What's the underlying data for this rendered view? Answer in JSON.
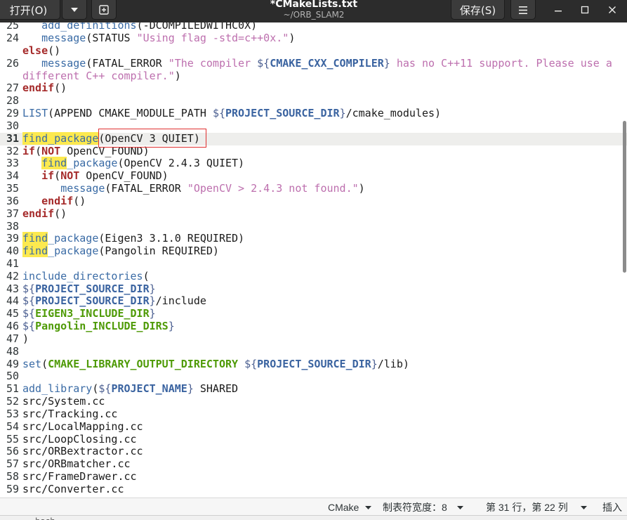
{
  "window": {
    "title": "*CMakeLists.txt",
    "subtitle": "~/ORB_SLAM2"
  },
  "header": {
    "open_label": "打开(O)",
    "save_label": "保存(S)",
    "icons": {
      "open_dropdown": "chevron-down-icon",
      "new_tab": "new-tab-icon",
      "menu": "hamburger-menu-icon",
      "minimize": "minimize-icon",
      "maximize": "maximize-icon",
      "close": "close-icon"
    }
  },
  "syntax_colors": {
    "command": "#3a6ba5",
    "keyword": "#a52a2a",
    "string": "#bd6fae",
    "variable_delimiter": "#4b5f91",
    "variable": "#3a63a0",
    "builtin_variable": "#4e9a06",
    "search_match_bg": "#fce94f",
    "current_line_bg": "#eeeeec",
    "annotation_box": "#e02f2f"
  },
  "editor": {
    "lines": [
      {
        "n": "25",
        "tk": [
          [
            "   ",
            ""
          ],
          [
            "add_definitions",
            "cmd"
          ],
          [
            "(-DCOMPILEDWITHC0X)",
            ""
          ]
        ]
      },
      {
        "n": "24",
        "tk": [
          [
            "   ",
            ""
          ],
          [
            "message",
            "cmd"
          ],
          [
            "(STATUS ",
            ""
          ],
          [
            "\"Using flag -std=c++0x.\"",
            "str"
          ],
          [
            ")",
            ""
          ]
        ]
      },
      {
        "n": "",
        "tk": [
          [
            "else",
            "kw"
          ],
          [
            "()",
            ""
          ]
        ]
      },
      {
        "n": "26",
        "tk": [
          [
            "   ",
            ""
          ],
          [
            "message",
            "cmd"
          ],
          [
            "(FATAL_ERROR ",
            ""
          ],
          [
            "\"The compiler ",
            "str"
          ],
          [
            "${",
            "vd"
          ],
          [
            "CMAKE_CXX_COMPILER",
            "vb"
          ],
          [
            "}",
            "vd"
          ],
          [
            " has no C++11 support. Please use a",
            "str"
          ]
        ]
      },
      {
        "n": "",
        "tk": [
          [
            "different C++ compiler.\"",
            "str"
          ],
          [
            ")",
            ""
          ]
        ]
      },
      {
        "n": "27",
        "tk": [
          [
            "endif",
            "kw"
          ],
          [
            "()",
            ""
          ]
        ]
      },
      {
        "n": "28",
        "tk": []
      },
      {
        "n": "29",
        "tk": [
          [
            "LIST",
            "cmd"
          ],
          [
            "(APPEND CMAKE_MODULE_PATH ",
            ""
          ],
          [
            "${",
            "vd"
          ],
          [
            "PROJECT_SOURCE_DIR",
            "vb"
          ],
          [
            "}",
            "vd"
          ],
          [
            "/cmake_modules)",
            ""
          ]
        ]
      },
      {
        "n": "30",
        "tk": []
      },
      {
        "n": "31",
        "cur": true,
        "tk": [
          [
            "find_package",
            "cmd hl"
          ],
          [
            "(OpenCV 3 QUIET)",
            ""
          ]
        ]
      },
      {
        "n": "32",
        "tk": [
          [
            "if",
            "kw"
          ],
          [
            "(",
            ""
          ],
          [
            "NOT",
            "kw"
          ],
          [
            " OpenCV_FOUND)",
            ""
          ]
        ]
      },
      {
        "n": "33",
        "tk": [
          [
            "   ",
            ""
          ],
          [
            "find",
            "cmd hl"
          ],
          [
            "_package",
            "cmd"
          ],
          [
            "(OpenCV 2.4.3 QUIET)",
            ""
          ]
        ]
      },
      {
        "n": "34",
        "tk": [
          [
            "   ",
            ""
          ],
          [
            "if",
            "kw"
          ],
          [
            "(",
            ""
          ],
          [
            "NOT",
            "kw"
          ],
          [
            " OpenCV_FOUND)",
            ""
          ]
        ]
      },
      {
        "n": "35",
        "tk": [
          [
            "      ",
            ""
          ],
          [
            "message",
            "cmd"
          ],
          [
            "(FATAL_ERROR ",
            ""
          ],
          [
            "\"OpenCV > 2.4.3 not found.\"",
            "str"
          ],
          [
            ")",
            ""
          ]
        ]
      },
      {
        "n": "36",
        "tk": [
          [
            "   ",
            ""
          ],
          [
            "endif",
            "kw"
          ],
          [
            "()",
            ""
          ]
        ]
      },
      {
        "n": "37",
        "tk": [
          [
            "endif",
            "kw"
          ],
          [
            "()",
            ""
          ]
        ]
      },
      {
        "n": "38",
        "tk": []
      },
      {
        "n": "39",
        "tk": [
          [
            "find",
            "cmd hl"
          ],
          [
            "_package",
            "cmd"
          ],
          [
            "(Eigen3 3.1.0 REQUIRED)",
            ""
          ]
        ]
      },
      {
        "n": "40",
        "tk": [
          [
            "find",
            "cmd hl"
          ],
          [
            "_package",
            "cmd"
          ],
          [
            "(Pangolin REQUIRED)",
            ""
          ]
        ]
      },
      {
        "n": "41",
        "tk": []
      },
      {
        "n": "42",
        "tk": [
          [
            "include_directories",
            "cmd"
          ],
          [
            "(",
            ""
          ]
        ]
      },
      {
        "n": "43",
        "tk": [
          [
            "${",
            "vd"
          ],
          [
            "PROJECT_SOURCE_DIR",
            "vb"
          ],
          [
            "}",
            "vd"
          ]
        ]
      },
      {
        "n": "44",
        "tk": [
          [
            "${",
            "vd"
          ],
          [
            "PROJECT_SOURCE_DIR",
            "vb"
          ],
          [
            "}",
            "vd"
          ],
          [
            "/include",
            ""
          ]
        ]
      },
      {
        "n": "45",
        "tk": [
          [
            "${",
            "vd"
          ],
          [
            "EIGEN3_INCLUDE_DIR",
            "vg"
          ],
          [
            "}",
            "vd"
          ]
        ]
      },
      {
        "n": "46",
        "tk": [
          [
            "${",
            "vd"
          ],
          [
            "Pangolin_INCLUDE_DIRS",
            "vg"
          ],
          [
            "}",
            "vd"
          ]
        ]
      },
      {
        "n": "47",
        "tk": [
          [
            ")",
            ""
          ]
        ]
      },
      {
        "n": "48",
        "tk": []
      },
      {
        "n": "49",
        "tk": [
          [
            "set",
            "cmd"
          ],
          [
            "(",
            ""
          ],
          [
            "CMAKE_LIBRARY_OUTPUT_DIRECTORY",
            "vg"
          ],
          [
            " ",
            ""
          ],
          [
            "${",
            "vd"
          ],
          [
            "PROJECT_SOURCE_DIR",
            "vb"
          ],
          [
            "}",
            "vd"
          ],
          [
            "/lib)",
            ""
          ]
        ]
      },
      {
        "n": "50",
        "tk": []
      },
      {
        "n": "51",
        "tk": [
          [
            "add_library",
            "cmd"
          ],
          [
            "(",
            ""
          ],
          [
            "${",
            "vd"
          ],
          [
            "PROJECT_NAME",
            "vb"
          ],
          [
            "}",
            "vd"
          ],
          [
            " SHARED",
            ""
          ]
        ]
      },
      {
        "n": "52",
        "tk": [
          [
            "src/System.cc",
            ""
          ]
        ]
      },
      {
        "n": "53",
        "tk": [
          [
            "src/Tracking.cc",
            ""
          ]
        ]
      },
      {
        "n": "54",
        "tk": [
          [
            "src/LocalMapping.cc",
            ""
          ]
        ]
      },
      {
        "n": "55",
        "tk": [
          [
            "src/LoopClosing.cc",
            ""
          ]
        ]
      },
      {
        "n": "56",
        "tk": [
          [
            "src/ORBextractor.cc",
            ""
          ]
        ]
      },
      {
        "n": "57",
        "tk": [
          [
            "src/ORBmatcher.cc",
            ""
          ]
        ]
      },
      {
        "n": "58",
        "tk": [
          [
            "src/FrameDrawer.cc",
            ""
          ]
        ]
      },
      {
        "n": "59",
        "tk": [
          [
            "src/Converter.cc",
            ""
          ]
        ]
      }
    ]
  },
  "statusbar": {
    "language": "CMake",
    "tab_width": "制表符宽度：8",
    "cursor_position": "第 31 行，第 22 列",
    "insert_mode": "插入",
    "dropdown_icon": "chevron-down-icon"
  },
  "bottom_panel": {
    "tab_label": "bash"
  }
}
